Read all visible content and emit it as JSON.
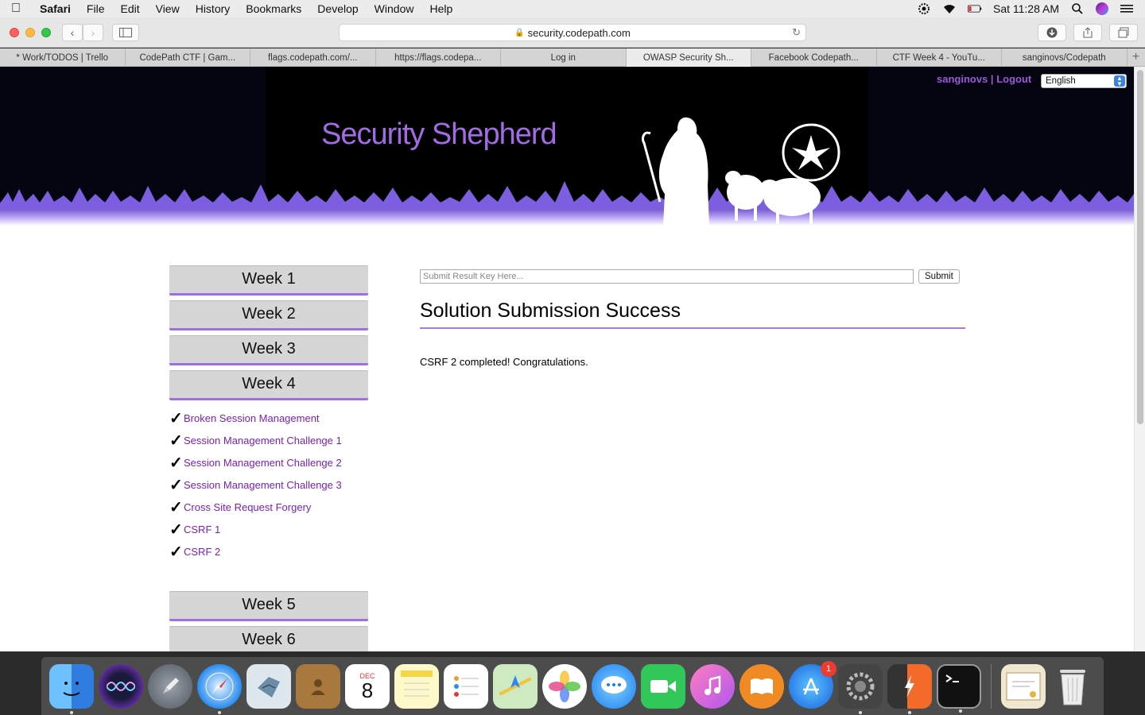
{
  "menubar": {
    "app": "Safari",
    "items": [
      "File",
      "Edit",
      "View",
      "History",
      "Bookmarks",
      "Develop",
      "Window",
      "Help"
    ],
    "clock": "Sat 11:28 AM"
  },
  "browser": {
    "url": "security.codepath.com",
    "tabs": [
      "* Work/TODOS | Trello",
      "CodePath CTF | Gam...",
      "flags.codepath.com/...",
      "https://flags.codepa...",
      "Log in",
      "OWASP Security Sh...",
      "Facebook Codepath...",
      "CTF Week 4 - YouTu...",
      "sanginovs/Codepath"
    ],
    "active_tab_index": 5
  },
  "header": {
    "site_title": "Security Shepherd",
    "username": "sanginovs",
    "separator": "|",
    "logout": "Logout",
    "language": "English"
  },
  "sidebar": {
    "weeks_top": [
      "Week 1",
      "Week 2",
      "Week 3",
      "Week 4"
    ],
    "lessons": [
      "Broken Session Management",
      "Session Management Challenge 1",
      "Session Management Challenge 2",
      "Session Management Challenge 3",
      "Cross Site Request Forgery",
      "CSRF 1",
      "CSRF 2"
    ],
    "check_glyph": "✓",
    "weeks_bottom": [
      "Week 5",
      "Week 6"
    ]
  },
  "main": {
    "key_placeholder": "Submit Result Key Here...",
    "submit_label": "Submit",
    "result_title": "Solution Submission Success",
    "result_message": "CSRF 2 completed! Congratulations."
  },
  "dock": {
    "apps": [
      "finder",
      "siri",
      "launchpad",
      "safari",
      "mail",
      "contacts",
      "calendar",
      "notes",
      "reminders",
      "maps",
      "photos",
      "messages",
      "facetime",
      "itunes",
      "ibooks",
      "app-store",
      "system-preferences",
      "burp-suite",
      "terminal"
    ],
    "calendar_month": "DEC",
    "calendar_day": "8",
    "app_store_badge": "1",
    "accent_colors": {
      "page_accent": "#a26be4",
      "link": "#7a1fb8"
    }
  }
}
